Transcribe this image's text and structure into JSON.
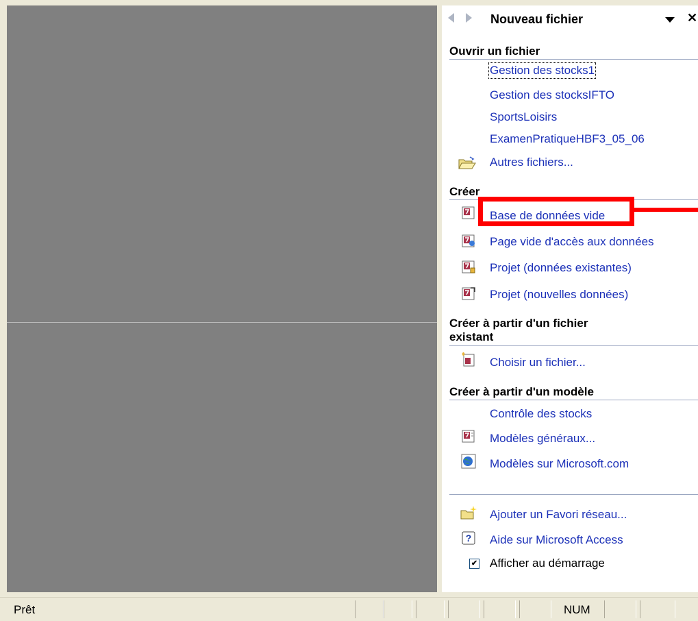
{
  "taskpane": {
    "title": "Nouveau fichier",
    "close_glyph": "✕",
    "sections": {
      "open": {
        "title": "Ouvrir un fichier",
        "items": [
          {
            "label": "Gestion des stocks1"
          },
          {
            "label": "Gestion des stocksIFTO"
          },
          {
            "label": "SportsLoisirs"
          },
          {
            "label": "ExamenPratiqueHBF3_05_06"
          },
          {
            "label": "Autres fichiers...",
            "icon": "open-folder-icon"
          }
        ]
      },
      "create": {
        "title": "Créer",
        "items": [
          {
            "label": "Base de données vide",
            "icon": "access-database-icon"
          },
          {
            "label": "Page vide d'accès aux données",
            "icon": "data-access-page-icon"
          },
          {
            "label": "Projet (données existantes)",
            "icon": "project-existing-data-icon"
          },
          {
            "label": "Projet (nouvelles données)",
            "icon": "project-new-data-icon"
          }
        ]
      },
      "from_file": {
        "title_line1": "Créer à partir d'un fichier",
        "title_line2": "existant",
        "items": [
          {
            "label": "Choisir un fichier...",
            "icon": "choose-file-icon"
          }
        ]
      },
      "from_template": {
        "title": "Créer à partir d'un modèle",
        "items": [
          {
            "label": "Contrôle des stocks"
          },
          {
            "label": "Modèles généraux...",
            "icon": "templates-icon"
          },
          {
            "label": "Modèles sur Microsoft.com",
            "icon": "globe-icon"
          }
        ]
      }
    },
    "footer": {
      "add_network": "Ajouter un Favori réseau...",
      "help": "Aide sur Microsoft Access",
      "show_at_startup": "Afficher au démarrage",
      "show_at_startup_checked": true
    }
  },
  "statusbar": {
    "status": "Prêt",
    "num": "NUM"
  },
  "colors": {
    "link": "#1c31b8",
    "highlight": "#ff0000",
    "workspace": "#808080"
  }
}
